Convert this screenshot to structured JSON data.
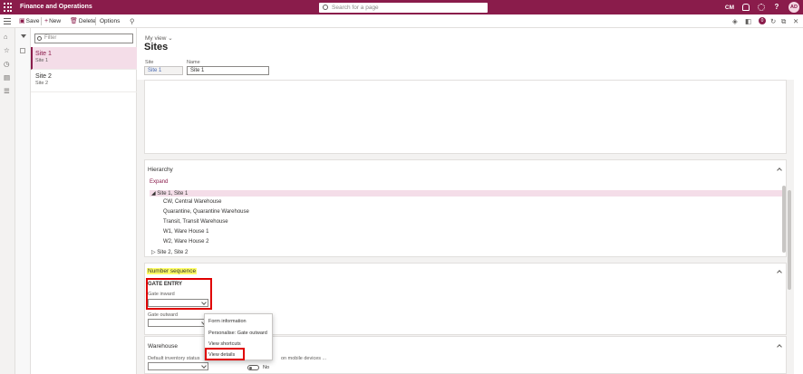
{
  "topbar": {
    "app_title": "Finance and Operations",
    "search_placeholder": "Search for a page",
    "company": "CM",
    "help": "?",
    "avatar": "AD"
  },
  "toolbar": {
    "save": "Save",
    "new": "New",
    "delete": "Delete",
    "options": "Options",
    "badge": "0"
  },
  "list": {
    "filter_placeholder": "Filter",
    "items": [
      {
        "title": "Site 1",
        "subtitle": "Site 1"
      },
      {
        "title": "Site 2",
        "subtitle": "Site 2"
      }
    ]
  },
  "header": {
    "my_view": "My view",
    "page_title": "Sites",
    "site_label": "Site",
    "site_value": "Site 1",
    "name_label": "Name",
    "name_value": "Site 1"
  },
  "hierarchy": {
    "title": "Hierarchy",
    "expand": "Expand",
    "root_selected": "Site 1, Site 1",
    "children": [
      "CW, Central Warehouse",
      "Quarantine, Quarantine Warehouse",
      "Transit, Transit Warehouse",
      "W1, Ware House 1",
      "W2, Ware House 2"
    ],
    "root_other": "Site 2, Site 2"
  },
  "number_sequence": {
    "title": "Number sequence",
    "group_title": "GATE ENTRY",
    "gate_inward_label": "Gate inward",
    "gate_outward_label": "Gate outward"
  },
  "context_menu": {
    "items": [
      "Form information",
      "Personalise: Gate outward",
      "View shortcuts",
      "View details"
    ]
  },
  "warehouse": {
    "title": "Warehouse",
    "default_status_label": "Default inventory status",
    "mobile_label": "on mobile devices ...",
    "toggle_value": "No"
  }
}
